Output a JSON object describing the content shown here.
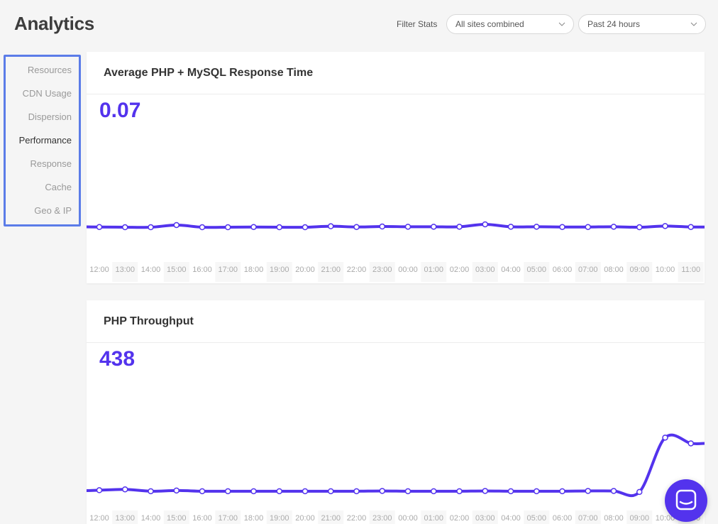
{
  "page": {
    "title": "Analytics"
  },
  "filters": {
    "label": "Filter Stats",
    "sites": {
      "value": "All sites combined"
    },
    "period": {
      "value": "Past 24 hours"
    }
  },
  "sidebar": {
    "active": "Performance",
    "items": [
      {
        "label": "Resources"
      },
      {
        "label": "CDN Usage"
      },
      {
        "label": "Dispersion"
      },
      {
        "label": "Performance"
      },
      {
        "label": "Response"
      },
      {
        "label": "Cache"
      },
      {
        "label": "Geo & IP"
      }
    ]
  },
  "colors": {
    "accent": "#5333ed",
    "sidebar_border": "#5b7ce8"
  },
  "icons": {
    "select_caret": "chevron-down-icon",
    "chat": "chat-icon"
  },
  "charts": [
    {
      "title": "Average PHP + MySQL Response Time",
      "metric": "0.07"
    },
    {
      "title": "PHP Throughput",
      "metric": "438"
    }
  ],
  "chart_data": [
    {
      "type": "line",
      "title": "Average PHP + MySQL Response Time",
      "categories": [
        "12:00",
        "13:00",
        "14:00",
        "15:00",
        "16:00",
        "17:00",
        "18:00",
        "19:00",
        "20:00",
        "21:00",
        "22:00",
        "23:00",
        "00:00",
        "01:00",
        "02:00",
        "03:00",
        "04:00",
        "05:00",
        "06:00",
        "07:00",
        "08:00",
        "09:00",
        "10:00",
        "11:00"
      ],
      "series": [
        {
          "values": [
            0.069,
            0.068,
            0.068,
            0.077,
            0.068,
            0.068,
            0.069,
            0.068,
            0.068,
            0.072,
            0.069,
            0.071,
            0.07,
            0.07,
            0.07,
            0.08,
            0.07,
            0.07,
            0.069,
            0.069,
            0.07,
            0.068,
            0.073,
            0.069
          ]
        }
      ],
      "ylim": [
        0,
        0.45
      ],
      "grid": false,
      "color": "#5333ed"
    },
    {
      "type": "line",
      "title": "PHP Throughput",
      "categories": [
        "12:00",
        "13:00",
        "14:00",
        "15:00",
        "16:00",
        "17:00",
        "18:00",
        "19:00",
        "20:00",
        "21:00",
        "22:00",
        "23:00",
        "00:00",
        "01:00",
        "02:00",
        "03:00",
        "04:00",
        "05:00",
        "06:00",
        "07:00",
        "08:00",
        "09:00",
        "10:00",
        "11:00"
      ],
      "series": [
        {
          "values": [
            72,
            78,
            65,
            70,
            65,
            65,
            65,
            65,
            65,
            65,
            65,
            67,
            65,
            65,
            65,
            67,
            65,
            65,
            65,
            67,
            67,
            60,
            438,
            398
          ]
        }
      ],
      "ylim": [
        0,
        840
      ],
      "grid": false,
      "color": "#5333ed"
    }
  ]
}
